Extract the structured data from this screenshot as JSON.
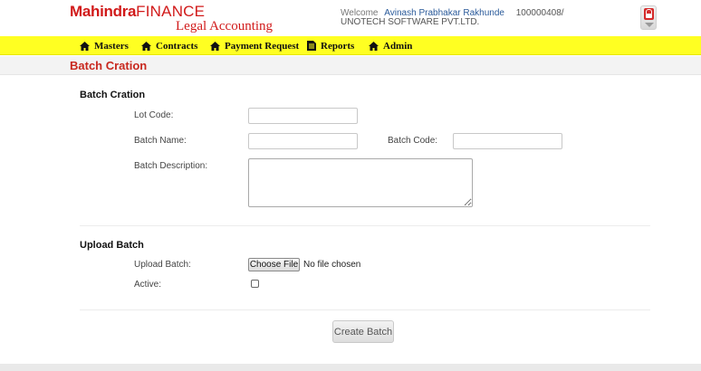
{
  "header": {
    "brand": "Mahindra",
    "brand_suffix": "FINANCE",
    "app_name": "Legal Accounting",
    "welcome_label": "Welcome",
    "user_name": "Avinash Prabhakar Rakhunde",
    "user_id": "100000408/",
    "company": "UNOTECH SOFTWARE PVT.LTD."
  },
  "nav": {
    "items": [
      {
        "label": "Masters",
        "icon": "home-icon"
      },
      {
        "label": "Contracts",
        "icon": "home-icon"
      },
      {
        "label": "Payment Request",
        "icon": "home-icon"
      },
      {
        "label": "Reports",
        "icon": "document-icon"
      },
      {
        "label": "Admin",
        "icon": "home-icon"
      }
    ]
  },
  "page": {
    "title": "Batch Cration"
  },
  "batch_section": {
    "title": "Batch Cration",
    "lot_code_label": "Lot Code:",
    "lot_code_value": "",
    "batch_name_label": "Batch Name:",
    "batch_name_value": "",
    "batch_code_label": "Batch Code:",
    "batch_code_value": "",
    "batch_description_label": "Batch Description:",
    "batch_description_value": ""
  },
  "upload_section": {
    "title": "Upload Batch",
    "upload_label": "Upload Batch:",
    "choose_file_label": "Choose File",
    "file_status": "No file chosen",
    "active_label": "Active:",
    "active_checked": false
  },
  "actions": {
    "create_batch_label": "Create Batch"
  },
  "colors": {
    "brand_red": "#d11a1a",
    "nav_yellow": "#ffff22",
    "title_red": "#c8281e",
    "user_link": "#2a5a9a"
  }
}
